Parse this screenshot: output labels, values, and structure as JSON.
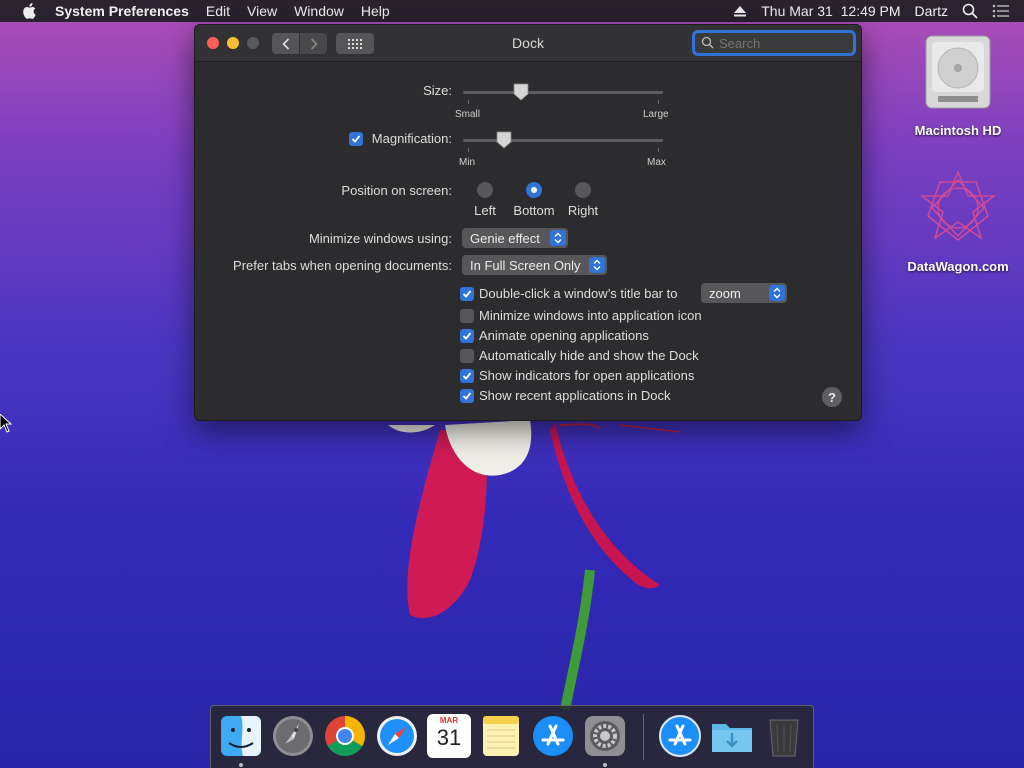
{
  "menubar": {
    "app_name": "System Preferences",
    "items": [
      "Edit",
      "View",
      "Window",
      "Help"
    ],
    "datetime": "Thu Mar 31  12:49 PM",
    "user": "Dartz"
  },
  "desktop": {
    "icons": [
      {
        "label": "Macintosh HD",
        "icon": "hard-drive-icon"
      },
      {
        "label": "DataWagon.com",
        "icon": "geometric-star-icon"
      }
    ]
  },
  "window": {
    "title": "Dock",
    "search_placeholder": "Search",
    "size": {
      "label": "Size:",
      "min_label": "Small",
      "max_label": "Large",
      "value": 0.3
    },
    "magnification": {
      "label": "Magnification:",
      "checked": true,
      "min_label": "Min",
      "max_label": "Max",
      "value": 0.2
    },
    "position": {
      "label": "Position on screen:",
      "options": [
        "Left",
        "Bottom",
        "Right"
      ],
      "selected": "Bottom"
    },
    "minimize_using": {
      "label": "Minimize windows using:",
      "value": "Genie effect"
    },
    "prefer_tabs": {
      "label": "Prefer tabs when opening documents:",
      "value": "In Full Screen Only"
    },
    "double_click": {
      "label": "Double-click a window’s title bar to",
      "checked": true,
      "value": "zoom"
    },
    "options": [
      {
        "label": "Minimize windows into application icon",
        "checked": false
      },
      {
        "label": "Animate opening applications",
        "checked": true
      },
      {
        "label": "Automatically hide and show the Dock",
        "checked": false
      },
      {
        "label": "Show indicators for open applications",
        "checked": true
      },
      {
        "label": "Show recent applications in Dock",
        "checked": true
      }
    ],
    "help_label": "?"
  },
  "dock": {
    "calendar_month": "MAR",
    "calendar_day": "31",
    "apps": [
      "Finder",
      "Launchpad",
      "Chrome",
      "Safari",
      "Calendar",
      "Notes",
      "App Store",
      "System Preferences",
      "App Store",
      "Downloads",
      "Trash"
    ]
  },
  "colors": {
    "accent": "#2f74d6",
    "close": "#fe5f57",
    "minimize": "#febc2e"
  }
}
